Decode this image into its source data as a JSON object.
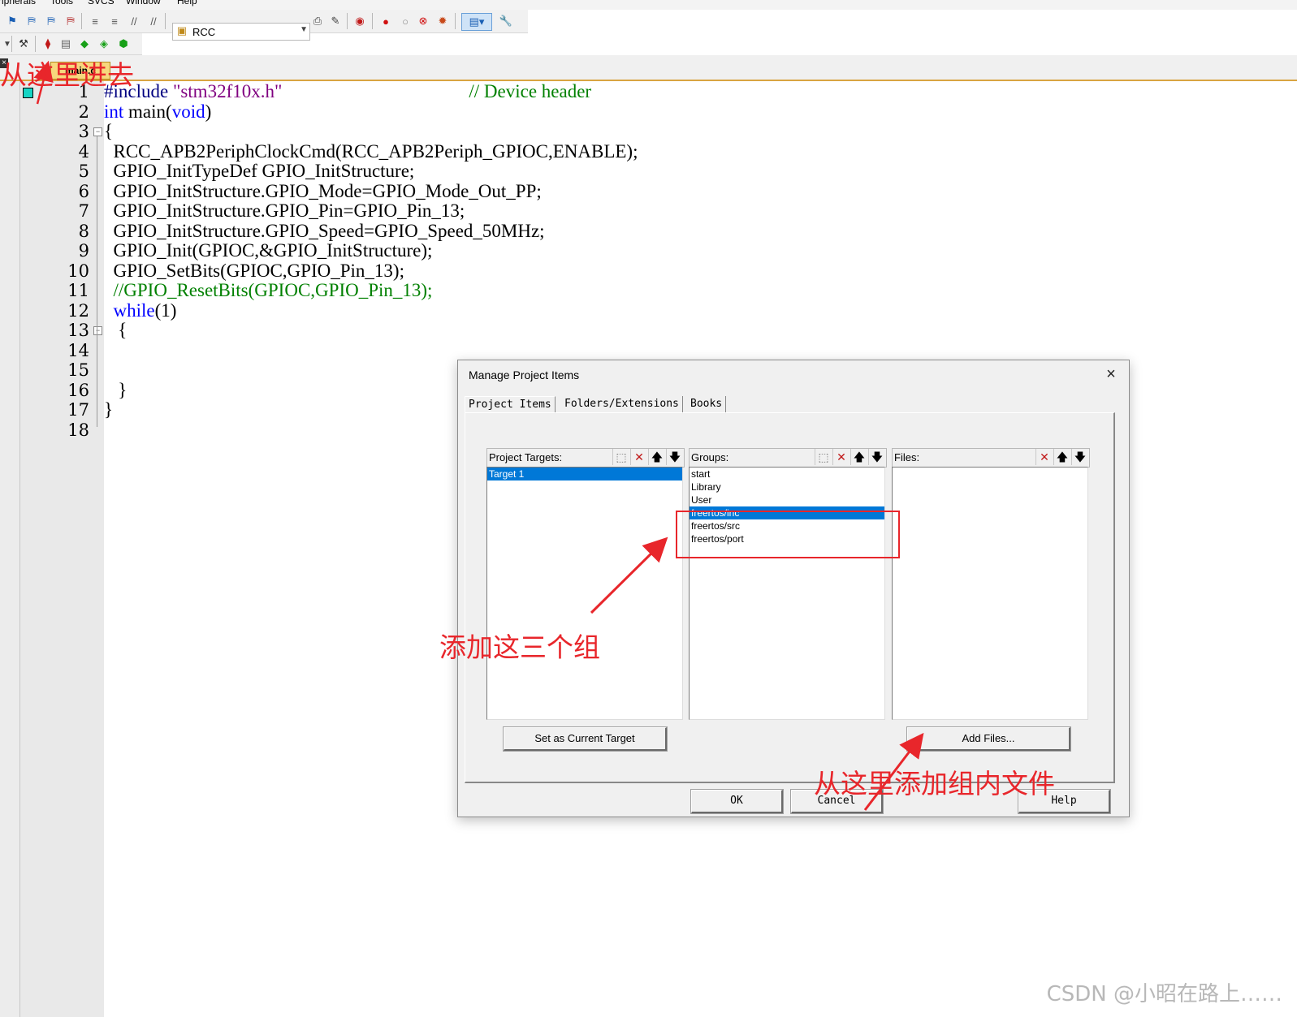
{
  "menubar": {
    "items": [
      "ripherals",
      "Tools",
      "SVCS",
      "Window",
      "Help"
    ]
  },
  "toolbar": {
    "target_name": "RCC"
  },
  "editor": {
    "file_tab": "main.c",
    "line_numbers": [
      "1",
      "2",
      "3",
      "4",
      "5",
      "6",
      "7",
      "8",
      "9",
      "10",
      "11",
      "12",
      "13",
      "14",
      "15",
      "16",
      "17",
      "18"
    ],
    "code": {
      "l1_directive": "#include",
      "l1_string": "\"stm32f10x.h\"",
      "l1_comment": "// Device header",
      "l2_kw": "int",
      "l2_mid": " main(",
      "l2_kw2": "void",
      "l2_end": ")",
      "l3": "{",
      "l4": "  RCC_APB2PeriphClockCmd(RCC_APB2Periph_GPIOC,ENABLE);",
      "l5": "  GPIO_InitTypeDef GPIO_InitStructure;",
      "l6": "  GPIO_InitStructure.GPIO_Mode=GPIO_Mode_Out_PP;",
      "l7": "  GPIO_InitStructure.GPIO_Pin=GPIO_Pin_13;",
      "l8": "  GPIO_InitStructure.GPIO_Speed=GPIO_Speed_50MHz;",
      "l9": "  GPIO_Init(GPIOC,&GPIO_InitStructure);",
      "l10": "  GPIO_SetBits(GPIOC,GPIO_Pin_13);",
      "l11": "  //GPIO_ResetBits(GPIOC,GPIO_Pin_13);",
      "l12_kw": "while",
      "l12_end": "(1)",
      "l13": "   {",
      "l16": "   }",
      "l17": "}"
    }
  },
  "dialog": {
    "title": "Manage Project Items",
    "close": "×",
    "tabs": [
      "Project Items",
      "Folders/Extensions",
      "Books"
    ],
    "targets": {
      "label": "Project Targets:",
      "items": [
        "Target 1"
      ],
      "selected": "Target 1"
    },
    "groups": {
      "label": "Groups:",
      "items": [
        "start",
        "Library",
        "User",
        "freertos/inc",
        "freertos/src",
        "freertos/port"
      ],
      "selected": "freertos/inc"
    },
    "files": {
      "label": "Files:",
      "items": []
    },
    "buttons": {
      "set_current": "Set as Current Target",
      "add_files": "Add Files...",
      "ok": "OK",
      "cancel": "Cancel",
      "help": "Help"
    }
  },
  "annotations": {
    "enter_here": "从这里进去",
    "add_three_groups": "添加这三个组",
    "add_files_here": "从这里添加组内文件"
  },
  "watermark": "CSDN @小昭在路上……",
  "colors": {
    "annotation": "#e8262b",
    "selection": "#0078d7",
    "keyword": "#0000ff",
    "comment": "#008000"
  }
}
